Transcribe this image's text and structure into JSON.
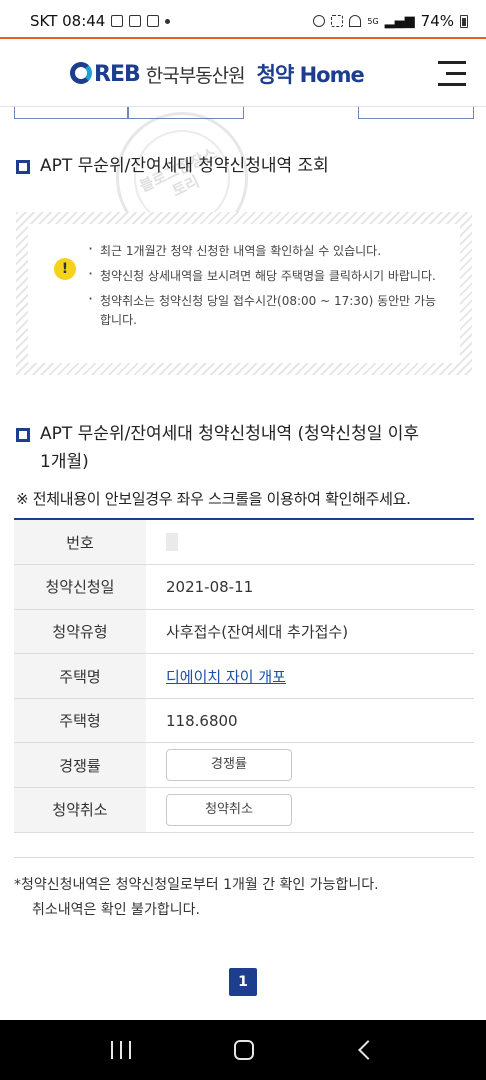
{
  "status_bar": {
    "carrier_time": "SKT 08:44",
    "network": "5G",
    "battery": "74%"
  },
  "header": {
    "logo_mark": "REB",
    "org_name": "한국부동산원",
    "brand_first": "청약",
    "brand_second": "Home",
    "menu_icon": "hamburger-icon"
  },
  "section1": {
    "title": "APT 무순위/잔여세대 청약신청내역 조회"
  },
  "notice": {
    "icon": "!",
    "items": [
      "최근 1개월간 청약 신청한 내역을 확인하실 수 있습니다.",
      "청약신청 상세내역을 보시려면 해당 주택명을 클릭하시기 바랍니다.",
      "청약취소는 청약신청 당일 접수시간(08:00 ~ 17:30) 동안만 가능합니다."
    ]
  },
  "section2": {
    "title_line1": "APT 무순위/잔여세대 청약신청내역 (청약신청일 이후",
    "title_line2": "1개월)"
  },
  "scroll_note": "※ 전체내용이 안보일경우 좌우 스크롤을 이용하여 확인해주세요.",
  "table": {
    "rows": [
      {
        "label": "번호",
        "value": ""
      },
      {
        "label": "청약신청일",
        "value": "2021-08-11"
      },
      {
        "label": "청약유형",
        "value": "사후접수(잔여세대 추가접수)"
      },
      {
        "label": "주택명",
        "value": "디에이치 자이 개포"
      },
      {
        "label": "주택형",
        "value": "118.6800"
      },
      {
        "label": "경쟁률",
        "value": "경쟁률"
      },
      {
        "label": "청약취소",
        "value": "청약취소"
      }
    ]
  },
  "footnote": {
    "line1": "*청약신청내역은 청약신청일로부터 1개월 간 확인 가능합니다.",
    "line2": "취소내역은 확인 불가합니다."
  },
  "pagination": {
    "current": "1"
  },
  "watermark": {
    "text": "블로그한장스토리"
  }
}
